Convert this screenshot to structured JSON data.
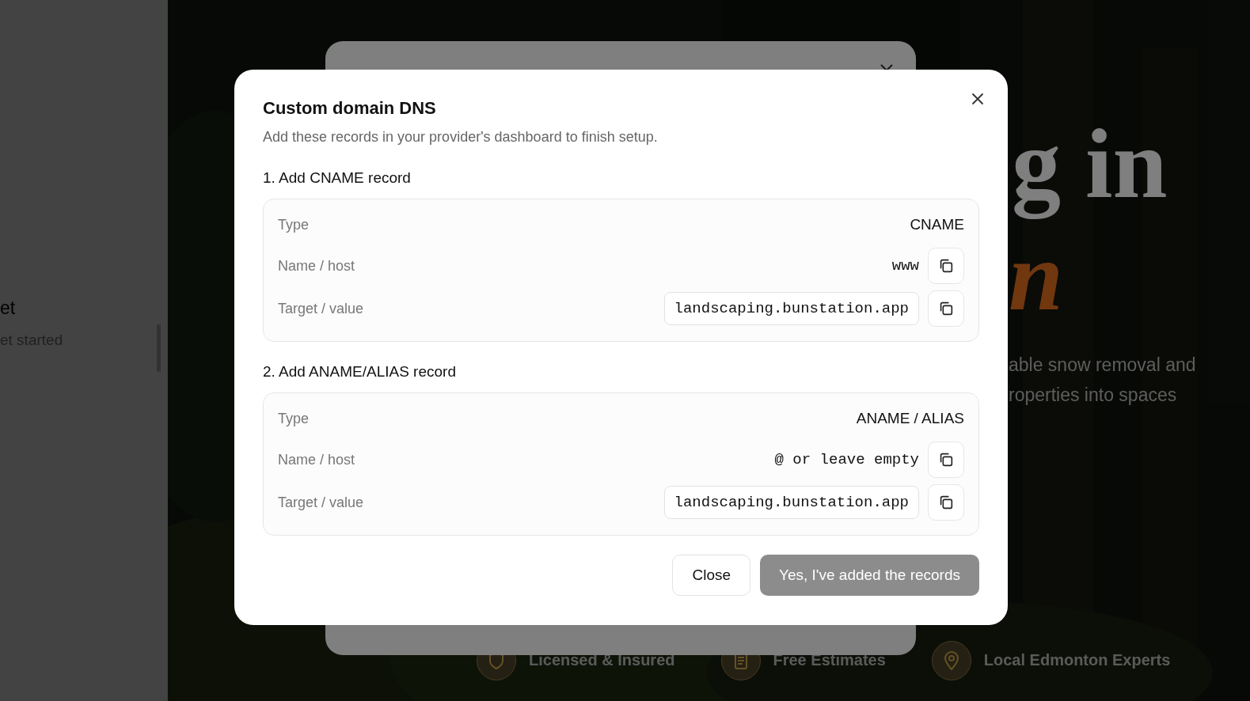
{
  "sidebar": {
    "heading": "et",
    "subheading": "et started"
  },
  "hero": {
    "title_line_1": "g in",
    "title_line_2": "n",
    "body_lines": [
      "able snow removal and",
      "roperties into spaces"
    ],
    "features": [
      {
        "label": "Licensed & Insured",
        "kind": "shield"
      },
      {
        "label": "Free Estimates",
        "kind": "list"
      },
      {
        "label": "Local Edmonton Experts",
        "kind": "pin"
      }
    ]
  },
  "dialog": {
    "title": "Custom domain DNS",
    "subtitle": "Add these records in your provider's dashboard to finish setup.",
    "sections": [
      {
        "heading": "1. Add CNAME record",
        "rows": [
          {
            "label": "Type",
            "value": "CNAME",
            "kind": "plain"
          },
          {
            "label": "Name / host",
            "value": "www",
            "kind": "code"
          },
          {
            "label": "Target / value",
            "value": "landscaping.bunstation.app",
            "kind": "field"
          }
        ]
      },
      {
        "heading": "2. Add ANAME/ALIAS record",
        "rows": [
          {
            "label": "Type",
            "value": "ANAME / ALIAS",
            "kind": "plain"
          },
          {
            "label": "Name / host",
            "value": "@ or leave empty",
            "kind": "code"
          },
          {
            "label": "Target / value",
            "value": "landscaping.bunstation.app",
            "kind": "field"
          }
        ]
      }
    ],
    "buttons": [
      {
        "label": "Close",
        "kind": "secondary",
        "disabled": false
      },
      {
        "label": "Yes, I've added the records",
        "kind": "primary",
        "disabled": true
      }
    ]
  }
}
